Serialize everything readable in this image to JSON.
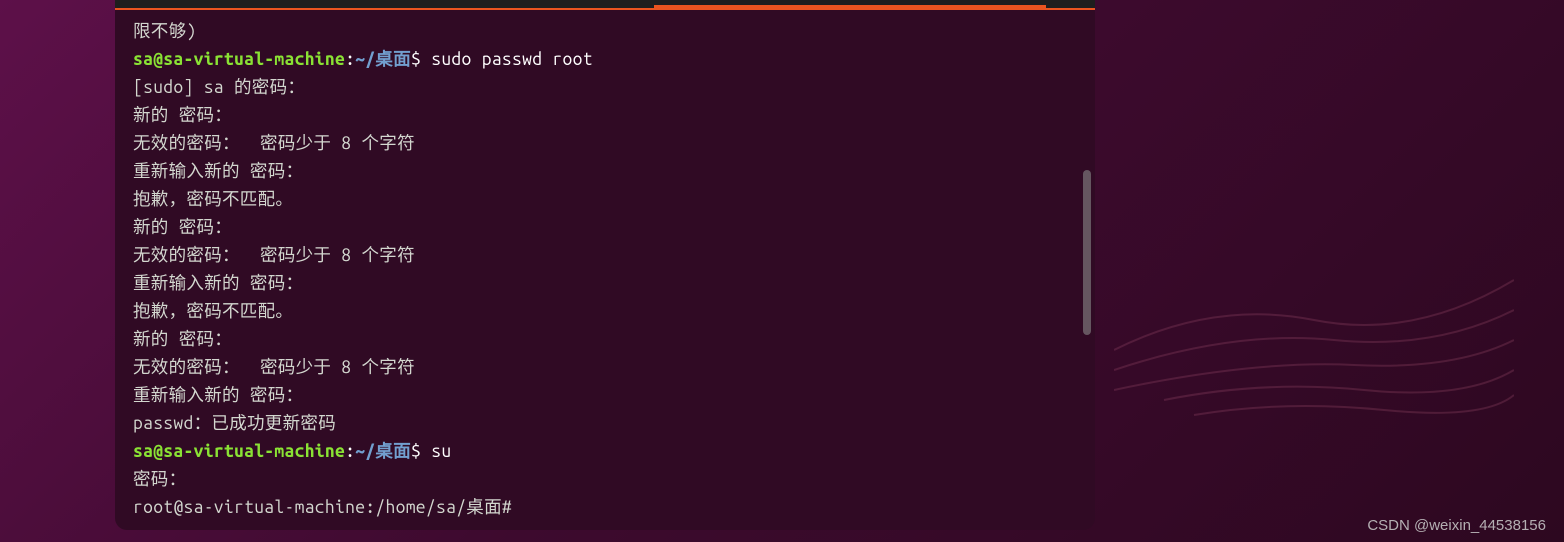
{
  "terminal": {
    "lines": [
      {
        "type": "output",
        "text": "限不够)"
      },
      {
        "type": "prompt1",
        "user": "sa@sa-virtual-machine",
        "colon": ":",
        "path": "~/桌面",
        "dollar": "$ ",
        "command": "sudo passwd root"
      },
      {
        "type": "output",
        "text": "[sudo] sa 的密码："
      },
      {
        "type": "output",
        "text": "新的 密码："
      },
      {
        "type": "output",
        "text": "无效的密码：  密码少于 8 个字符"
      },
      {
        "type": "output",
        "text": "重新输入新的 密码："
      },
      {
        "type": "output",
        "text": "抱歉，密码不匹配。"
      },
      {
        "type": "output",
        "text": "新的 密码："
      },
      {
        "type": "output",
        "text": "无效的密码：  密码少于 8 个字符"
      },
      {
        "type": "output",
        "text": "重新输入新的 密码："
      },
      {
        "type": "output",
        "text": "抱歉，密码不匹配。"
      },
      {
        "type": "output",
        "text": "新的 密码："
      },
      {
        "type": "output",
        "text": "无效的密码：  密码少于 8 个字符"
      },
      {
        "type": "output",
        "text": "重新输入新的 密码："
      },
      {
        "type": "output",
        "text": "passwd：已成功更新密码"
      },
      {
        "type": "prompt1",
        "user": "sa@sa-virtual-machine",
        "colon": ":",
        "path": "~/桌面",
        "dollar": "$ ",
        "command": "su"
      },
      {
        "type": "output",
        "text": "密码："
      },
      {
        "type": "rootprompt",
        "text": "root@sa-virtual-machine:/home/sa/桌面#"
      }
    ]
  },
  "watermark": "CSDN @weixin_44538156"
}
